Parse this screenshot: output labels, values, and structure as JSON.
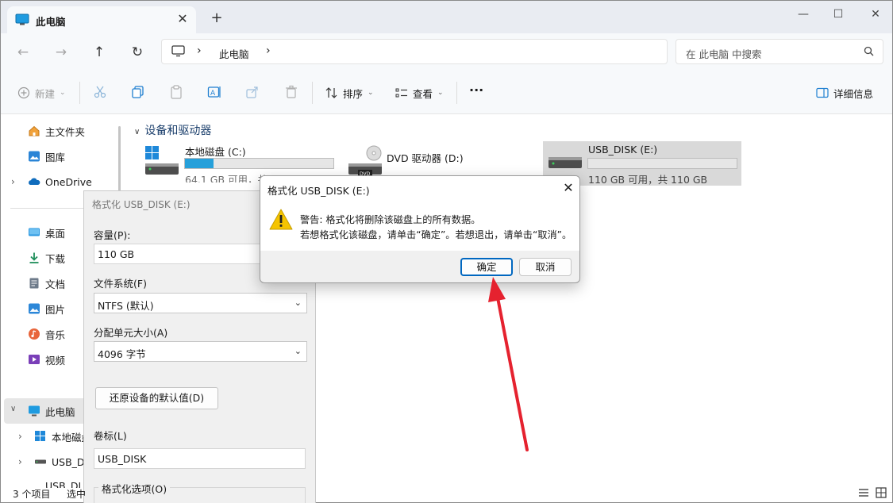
{
  "window": {
    "tab_title": "此电脑",
    "close_tab": "✕",
    "new_tab": "+",
    "minimize": "—",
    "maximize": "☐",
    "close": "✕"
  },
  "nav": {
    "back": "←",
    "forward": "→",
    "up": "↑",
    "refresh": "↻",
    "breadcrumb": [
      "此电脑"
    ],
    "breadcrumb_sep": "›",
    "search_placeholder": "在 此电脑 中搜索"
  },
  "toolbar": {
    "new_label": "新建",
    "sort_label": "排序",
    "view_label": "查看",
    "more_label": "···",
    "details_label": "详细信息"
  },
  "sidebar": {
    "items": [
      {
        "label": "主文件夹",
        "icon": "home-icon"
      },
      {
        "label": "图库",
        "icon": "gallery-icon"
      },
      {
        "label": "OneDrive",
        "icon": "cloud-icon"
      },
      {
        "label": "桌面",
        "icon": "desktop-icon"
      },
      {
        "label": "下载",
        "icon": "download-icon"
      },
      {
        "label": "文档",
        "icon": "document-icon"
      },
      {
        "label": "图片",
        "icon": "pictures-icon"
      },
      {
        "label": "音乐",
        "icon": "music-icon"
      },
      {
        "label": "视频",
        "icon": "video-icon"
      },
      {
        "label": "此电脑",
        "icon": "computer-icon"
      },
      {
        "label": "本地磁盘",
        "icon": "windows-drive-icon"
      },
      {
        "label": "USB_DI",
        "icon": "usb-drive-icon"
      },
      {
        "label": "USB_DI",
        "icon": "usb-drive-icon"
      }
    ]
  },
  "content": {
    "section_title": "设备和驱动器",
    "drives": [
      {
        "name": "本地磁盘 (C:)",
        "size": "64.1 GB 可用，共 79.6 GB",
        "used_fraction": 0.19
      },
      {
        "name": "DVD 驱动器 (D:)",
        "size": ""
      },
      {
        "name": "USB_DISK (E:)",
        "size": "110 GB 可用，共 110 GB",
        "used_fraction": 0.0
      }
    ]
  },
  "format_window": {
    "title": "格式化 USB_DISK (E:)",
    "capacity_label": "容量(P):",
    "capacity_value": "110 GB",
    "fs_label": "文件系统(F)",
    "fs_value": "NTFS (默认)",
    "alloc_label": "分配单元大小(A)",
    "alloc_value": "4096 字节",
    "restore_button": "还原设备的默认值(D)",
    "volume_label": "卷标(L)",
    "volume_value": "USB_DISK",
    "options_label": "格式化选项(O)"
  },
  "dialog": {
    "title": "格式化 USB_DISK (E:)",
    "line1": "警告: 格式化将删除该磁盘上的所有数据。",
    "line2": "若想格式化该磁盘，请单击“确定”。若想退出，请单击“取消”。",
    "ok": "确定",
    "cancel": "取消"
  },
  "status": {
    "count": "3 个项目",
    "selected": "选中"
  },
  "colors": {
    "accent": "#0067c0",
    "bar_fill": "#26a0da",
    "annotation_arrow": "#e5222f",
    "warning": "#f5c400"
  }
}
